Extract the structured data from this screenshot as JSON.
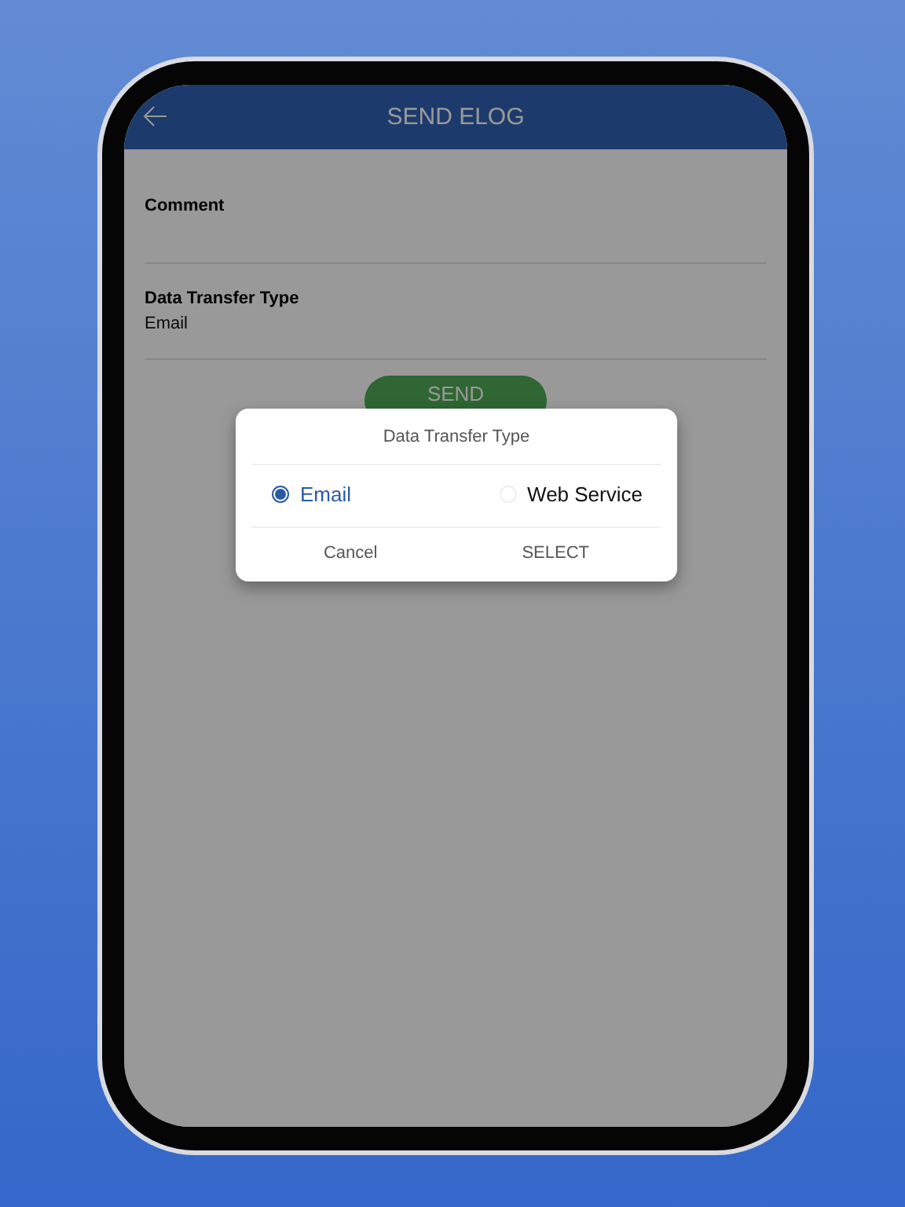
{
  "header": {
    "title": "SEND ELOG"
  },
  "fields": [
    {
      "label": "Comment"
    },
    {
      "label": "Data Transfer Type",
      "value": "Email"
    }
  ],
  "send_button": "SEND",
  "dialog": {
    "title": "Data Transfer Type",
    "options": [
      {
        "label": "Email",
        "selected": true
      },
      {
        "label": "Web Service",
        "selected": false
      }
    ],
    "buttons": [
      "Cancel",
      "SELECT"
    ]
  }
}
